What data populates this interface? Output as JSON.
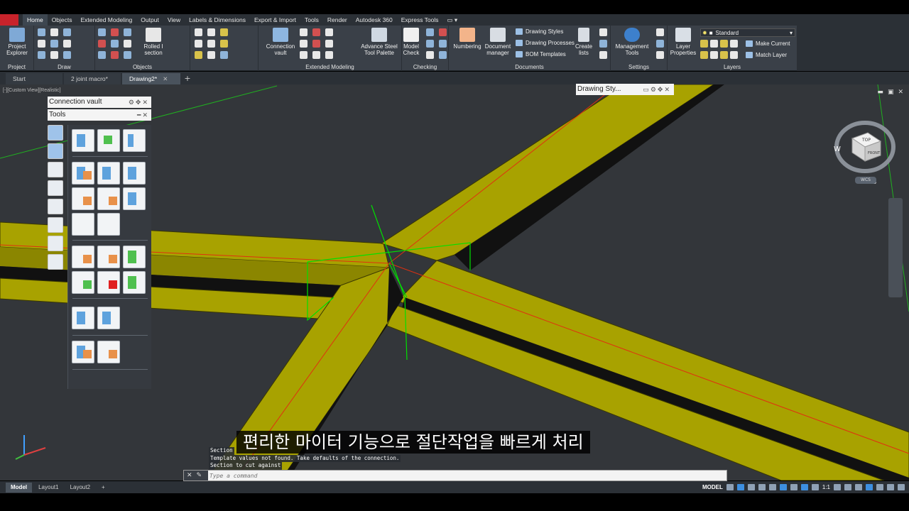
{
  "ribbon_tabs": [
    "Home",
    "Objects",
    "Extended Modeling",
    "Output",
    "View",
    "Labels & Dimensions",
    "Export & Import",
    "Tools",
    "Render",
    "Autodesk 360",
    "Express Tools"
  ],
  "active_tab": "Home",
  "panels": {
    "project": {
      "title": "Project",
      "button": "Project Explorer"
    },
    "draw": {
      "title": "Draw"
    },
    "objects": {
      "title": "Objects",
      "rolled_section": "Rolled I section"
    },
    "extended_modeling": {
      "title": "Extended Modeling",
      "connection_vault": "Connection vault",
      "advance_steel_tool_palette": "Advance Steel Tool Palette"
    },
    "checking": {
      "title": "Checking",
      "model_check": "Model Check"
    },
    "documents": {
      "title": "Documents",
      "numbering": "Numbering",
      "document_manager": "Document manager",
      "drawing_styles": "Drawing Styles",
      "drawing_processes": "Drawing Processes",
      "bom_templates": "BOM Templates",
      "create_lists": "Create lists"
    },
    "settings": {
      "title": "Settings",
      "management_tools": "Management Tools"
    },
    "layers": {
      "title": "Layers",
      "layer_properties": "Layer Properties",
      "standard": "Standard",
      "make_current": "Make Current",
      "match_layer": "Match Layer"
    }
  },
  "file_tabs": [
    {
      "label": "Start"
    },
    {
      "label": "2 joint macro*"
    },
    {
      "label": "Drawing2*"
    }
  ],
  "viewport": {
    "label": "[-][Custom View][Realistic]"
  },
  "palette": {
    "title": "Connection vault",
    "subtitle": "Tools"
  },
  "drawing_style_box": {
    "label": "Drawing Sty..."
  },
  "viewcube": {
    "top": "TOP",
    "front": "FRONT",
    "w": "W",
    "s": "S",
    "wcs": "WCS"
  },
  "subtitle_text": "편리한 마이터 기능으로 절단작업을 빠르게 처리",
  "command_history": [
    "Section",
    "Template values not found. Take defaults of the connection.",
    "Section to cut against"
  ],
  "command_placeholder": "Type a command",
  "layout_tabs": [
    "Model",
    "Layout1",
    "Layout2"
  ],
  "status": {
    "model": "MODEL",
    "scale": "1:1"
  },
  "colors": {
    "beam": "#a8a200",
    "beam_dark": "#6e6a00",
    "background": "#33363a",
    "ribbon": "#3a4048",
    "section_line": "#00e000",
    "axis_line": "#e03010"
  }
}
